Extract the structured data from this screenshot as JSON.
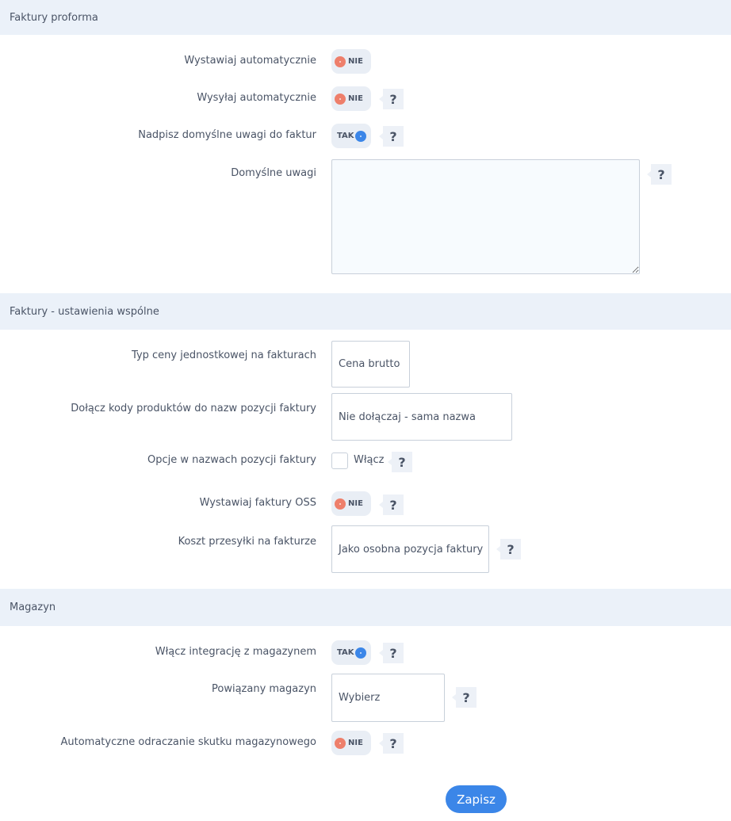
{
  "sections": {
    "proforma": {
      "title": "Faktury proforma",
      "rows": {
        "auto_issue": {
          "label": "Wystawiaj automatycznie",
          "state": "NIE"
        },
        "auto_send": {
          "label": "Wysyłaj automatycznie",
          "state": "NIE"
        },
        "override_notes": {
          "label": "Nadpisz domyślne uwagi do faktur",
          "state": "TAK"
        },
        "default_notes": {
          "label": "Domyślne uwagi",
          "value": ""
        }
      }
    },
    "common": {
      "title": "Faktury - ustawienia wspólne",
      "rows": {
        "price_type": {
          "label": "Typ ceny jednostkowej na fakturach",
          "value": "Cena brutto"
        },
        "product_codes": {
          "label": "Dołącz kody produktów do nazw pozycji faktury",
          "value": "Nie dołączaj - sama nazwa"
        },
        "item_options": {
          "label": "Opcje w nazwach pozycji faktury",
          "checkbox_label": "Włącz",
          "checked": false
        },
        "oss": {
          "label": "Wystawiaj faktury OSS",
          "state": "NIE"
        },
        "shipping_cost": {
          "label": "Koszt przesyłki na fakturze",
          "value": "Jako osobna pozycja faktury"
        }
      }
    },
    "warehouse": {
      "title": "Magazyn",
      "rows": {
        "integration": {
          "label": "Włącz integrację z magazynem",
          "state": "TAK"
        },
        "linked": {
          "label": "Powiązany magazyn",
          "value": "Wybierz"
        },
        "auto_reverse": {
          "label": "Automatyczne odraczanie skutku magazynowego",
          "state": "NIE"
        }
      }
    }
  },
  "help_symbol": "?",
  "save_label": "Zapisz",
  "colors": {
    "accent": "#3b86e8",
    "off": "#ee7f6b",
    "header_bg": "#ebf1f9"
  }
}
